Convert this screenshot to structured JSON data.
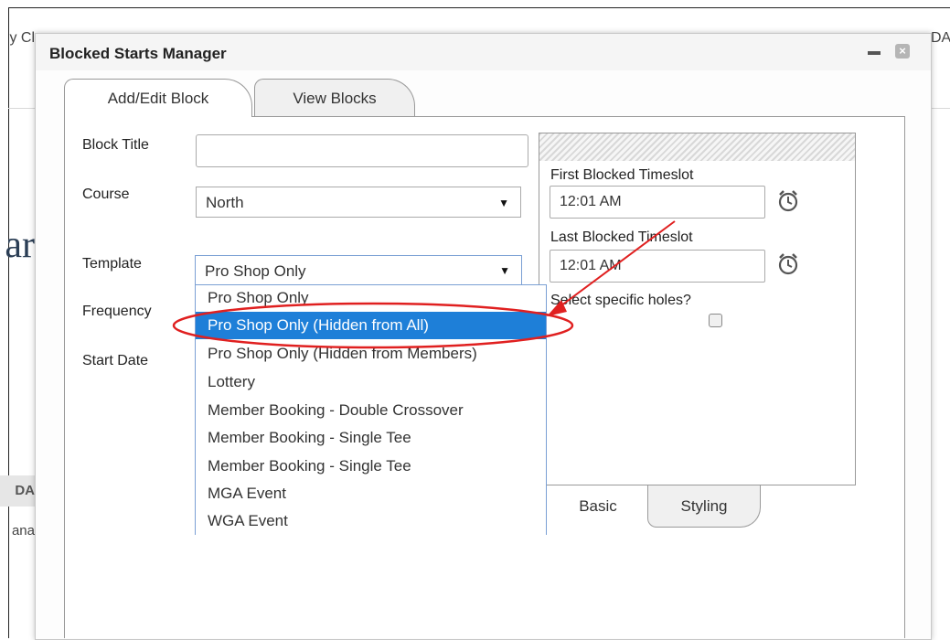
{
  "background": {
    "frag_top_left": "y Cl",
    "frag_top_right": "DA",
    "frag_ar": "ar",
    "frag_da": "DA",
    "frag_ana": "ana"
  },
  "dialog": {
    "title": "Blocked Starts Manager",
    "tabs": [
      {
        "label": "Add/Edit Block",
        "active": true
      },
      {
        "label": "View Blocks",
        "active": false
      }
    ]
  },
  "form": {
    "block_title": {
      "label": "Block Title",
      "value": ""
    },
    "course": {
      "label": "Course",
      "value": "North"
    },
    "template": {
      "label": "Template",
      "value": "Pro Shop Only"
    },
    "frequency": {
      "label": "Frequency"
    },
    "start_date": {
      "label": "Start Date"
    }
  },
  "template_options": [
    "Pro Shop Only",
    "Pro Shop Only (Hidden from All)",
    "Pro Shop Only (Hidden from Members)",
    "Lottery",
    "Member Booking - Double Crossover",
    "Member Booking - Single Tee",
    "Member Booking - Single Tee",
    "MGA Event",
    "WGA Event"
  ],
  "selected_option_index": 1,
  "timeslots": {
    "first_label": "First Blocked Timeslot",
    "first_value": "12:01 AM",
    "last_label": "Last Blocked Timeslot",
    "last_value": "12:01 AM",
    "holes_label": "Select specific holes?",
    "holes_checked": false
  },
  "bottom_tabs": [
    {
      "label": "Basic",
      "active": true
    },
    {
      "label": "Styling",
      "active": false
    }
  ],
  "colors": {
    "selection": "#1e7fd8",
    "annotation": "#e02020"
  },
  "icons": {
    "minimize": "minimize-icon",
    "close": "close-icon",
    "clock": "clock-icon",
    "dropdown_arrow": "triangle-down-icon"
  }
}
